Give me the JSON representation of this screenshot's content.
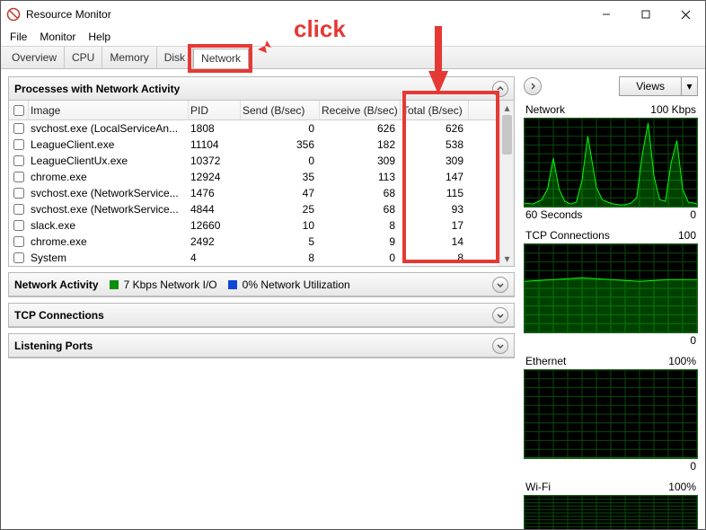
{
  "window": {
    "title": "Resource Monitor"
  },
  "menu": {
    "file": "File",
    "monitor": "Monitor",
    "help": "Help"
  },
  "tabs": {
    "overview": "Overview",
    "cpu": "CPU",
    "memory": "Memory",
    "disk": "Disk",
    "network": "Network"
  },
  "annotations": {
    "click_label": "click"
  },
  "processes_panel": {
    "title": "Processes with Network Activity",
    "columns": {
      "image": "Image",
      "pid": "PID",
      "send": "Send (B/sec)",
      "receive": "Receive (B/sec)",
      "total": "Total (B/sec)"
    },
    "rows": [
      {
        "image": "svchost.exe (LocalServiceAn...",
        "pid": "1808",
        "send": "0",
        "receive": "626",
        "total": "626"
      },
      {
        "image": "LeagueClient.exe",
        "pid": "11104",
        "send": "356",
        "receive": "182",
        "total": "538"
      },
      {
        "image": "LeagueClientUx.exe",
        "pid": "10372",
        "send": "0",
        "receive": "309",
        "total": "309"
      },
      {
        "image": "chrome.exe",
        "pid": "12924",
        "send": "35",
        "receive": "113",
        "total": "147"
      },
      {
        "image": "svchost.exe (NetworkService...",
        "pid": "1476",
        "send": "47",
        "receive": "68",
        "total": "115"
      },
      {
        "image": "svchost.exe (NetworkService...",
        "pid": "4844",
        "send": "25",
        "receive": "68",
        "total": "93"
      },
      {
        "image": "slack.exe",
        "pid": "12660",
        "send": "10",
        "receive": "8",
        "total": "17"
      },
      {
        "image": "chrome.exe",
        "pid": "2492",
        "send": "5",
        "receive": "9",
        "total": "14"
      },
      {
        "image": "System",
        "pid": "4",
        "send": "8",
        "receive": "0",
        "total": "8"
      }
    ]
  },
  "network_activity": {
    "title": "Network Activity",
    "io_label": "7 Kbps Network I/O",
    "util_label": "0% Network Utilization"
  },
  "tcp_panel": {
    "title": "TCP Connections"
  },
  "listening_panel": {
    "title": "Listening Ports"
  },
  "right": {
    "views_label": "Views",
    "charts": {
      "network": {
        "title": "Network",
        "scale": "100 Kbps",
        "foot_left": "60 Seconds",
        "foot_right": "0"
      },
      "tcp": {
        "title": "TCP Connections",
        "scale": "100",
        "foot_right": "0"
      },
      "ethernet": {
        "title": "Ethernet",
        "scale": "100%",
        "foot_right": "0"
      },
      "wifi": {
        "title": "Wi-Fi",
        "scale": "100%"
      }
    }
  },
  "chart_data": [
    {
      "type": "area",
      "title": "Network",
      "ylabel": "Kbps",
      "ylim": [
        0,
        100
      ],
      "xlim": [
        -60,
        0
      ],
      "x": [
        -60,
        -57,
        -54,
        -52,
        -50,
        -48,
        -46,
        -44,
        -42,
        -40,
        -38,
        -35,
        -33,
        -31,
        -29,
        -27,
        -25,
        -23,
        -21,
        -19,
        -17,
        -15,
        -13,
        -11,
        -9,
        -7,
        -5,
        -3,
        -1,
        0
      ],
      "values": [
        4,
        3,
        8,
        20,
        55,
        20,
        6,
        3,
        5,
        30,
        80,
        22,
        8,
        5,
        3,
        2,
        2,
        4,
        10,
        60,
        95,
        35,
        8,
        6,
        50,
        75,
        20,
        5,
        4,
        3
      ]
    },
    {
      "type": "area",
      "title": "TCP Connections",
      "ylim": [
        0,
        100
      ],
      "xlim": [
        -60,
        0
      ],
      "x": [
        -60,
        -50,
        -40,
        -30,
        -20,
        -10,
        0
      ],
      "values": [
        58,
        60,
        62,
        60,
        58,
        60,
        60
      ]
    },
    {
      "type": "area",
      "title": "Ethernet",
      "ylabel": "%",
      "ylim": [
        0,
        100
      ],
      "xlim": [
        -60,
        0
      ],
      "x": [
        -60,
        0
      ],
      "values": [
        0,
        0
      ]
    },
    {
      "type": "area",
      "title": "Wi-Fi",
      "ylabel": "%",
      "ylim": [
        0,
        100
      ],
      "xlim": [
        -60,
        0
      ],
      "x": [
        -60,
        0
      ],
      "values": [
        0,
        0
      ]
    }
  ]
}
